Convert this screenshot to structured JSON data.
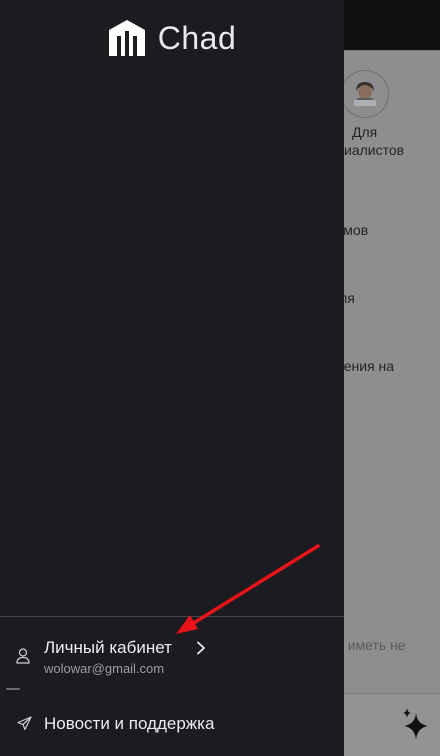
{
  "drawer": {
    "app_title": "Chad",
    "account": {
      "name": "Личный кабинет",
      "email": "wolowar@gmail.com",
      "icon": "person-icon",
      "chevron_icon": "chevron-right-icon"
    },
    "news": {
      "label": "Новости и поддержка",
      "icon": "send-icon"
    },
    "colors": {
      "drawer_bg": "#1c1b1f",
      "text": "#ededf0",
      "subtext": "#9c9ca2"
    }
  },
  "background": {
    "specialists_line1": "Для",
    "specialists_line2": "циалистов",
    "row1": "ьмов",
    "row2": "іля",
    "row3": "нения на",
    "bottom_text": "и иметь не",
    "avatar_icon": "technologist-emoji-icon",
    "sparkle_icon": "sparkle-icon"
  },
  "annotation": {
    "arrow_color": "#e8141a",
    "icon": "red-arrow-icon"
  }
}
